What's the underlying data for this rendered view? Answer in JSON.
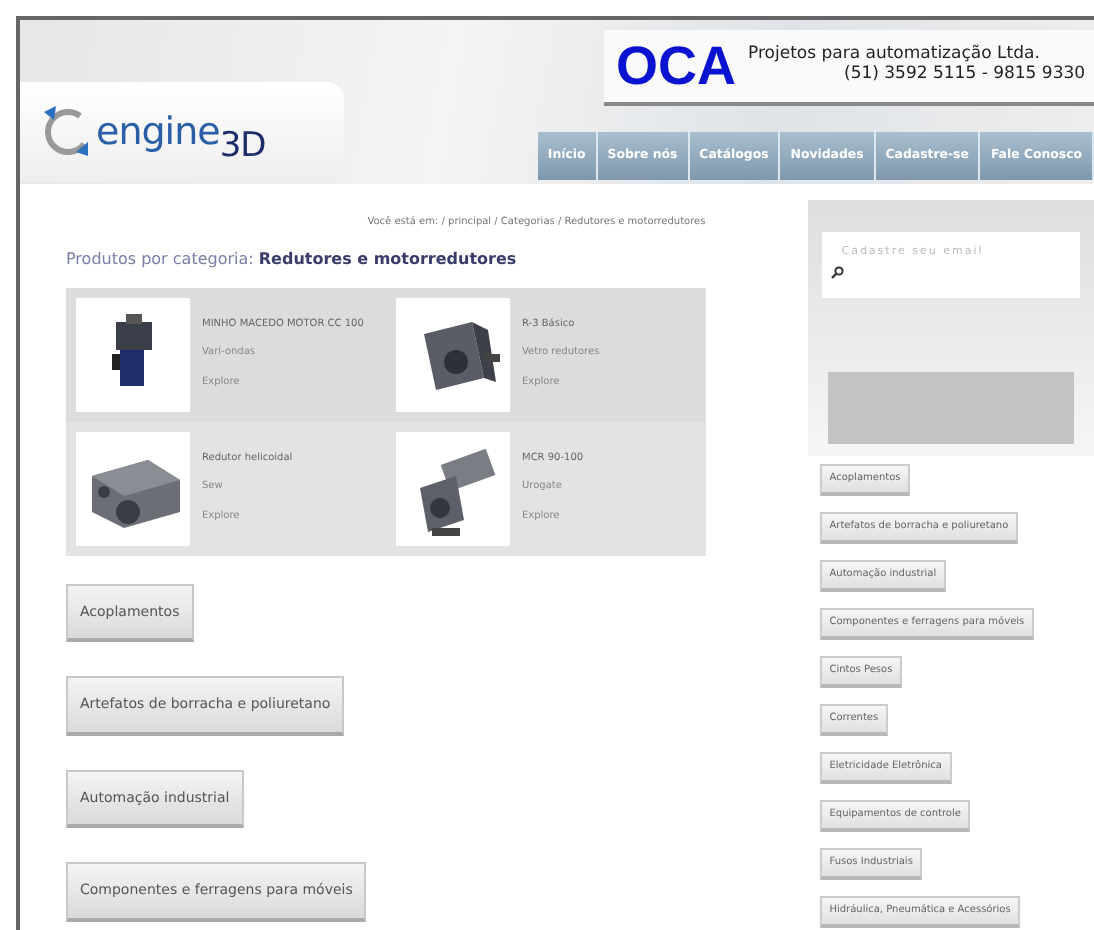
{
  "logo": {
    "text": "engine$_{3D}$"
  },
  "banner": {
    "brand": "OCA",
    "tagline": "Projetos para automatização Ltda.",
    "phone": "(51) 3592 5115 - 9815 9330"
  },
  "nav": [
    {
      "label": "Início"
    },
    {
      "label": "Sobre nós"
    },
    {
      "label": "Catálogos"
    },
    {
      "label": "Novidades"
    },
    {
      "label": "Cadastre-se"
    },
    {
      "label": "Fale Conosco"
    }
  ],
  "breadcrumb": "Você está em: / principal / Categorias / Redutores e motorredutores",
  "heading": {
    "prefix": "Produtos por categoria:",
    "category": "Redutores e motorredutores"
  },
  "products": [
    {
      "name": "MINHO MACEDO MOTOR CC 100",
      "brand": "Vari-ondas",
      "link": "Explore"
    },
    {
      "name": "R-3 Básico",
      "brand": "Vetro redutores",
      "link": "Explore"
    },
    {
      "name": "Redutor helicoidal",
      "brand": "Sew",
      "link": "Explore"
    },
    {
      "name": "MCR 90-100",
      "brand": "Urogate",
      "link": "Explore"
    }
  ],
  "categories": [
    "Acoplamentos",
    "Artefatos de borracha e poliuretano",
    "Automação industrial",
    "Componentes e ferragens para móveis"
  ],
  "sidebar": {
    "email_placeholder": "Cadastre seu email",
    "categories": [
      "Acoplamentos",
      "Artefatos de borracha e poliuretano",
      "Automação industrial",
      "Componentes e ferragens para móveis",
      "Cintos Pesos",
      "Correntes",
      "Eletricidade Eletrônica",
      "Equipamentos de controle",
      "Fusos Industriais",
      "Hidráulica, Pneumática e Acessórios"
    ]
  }
}
